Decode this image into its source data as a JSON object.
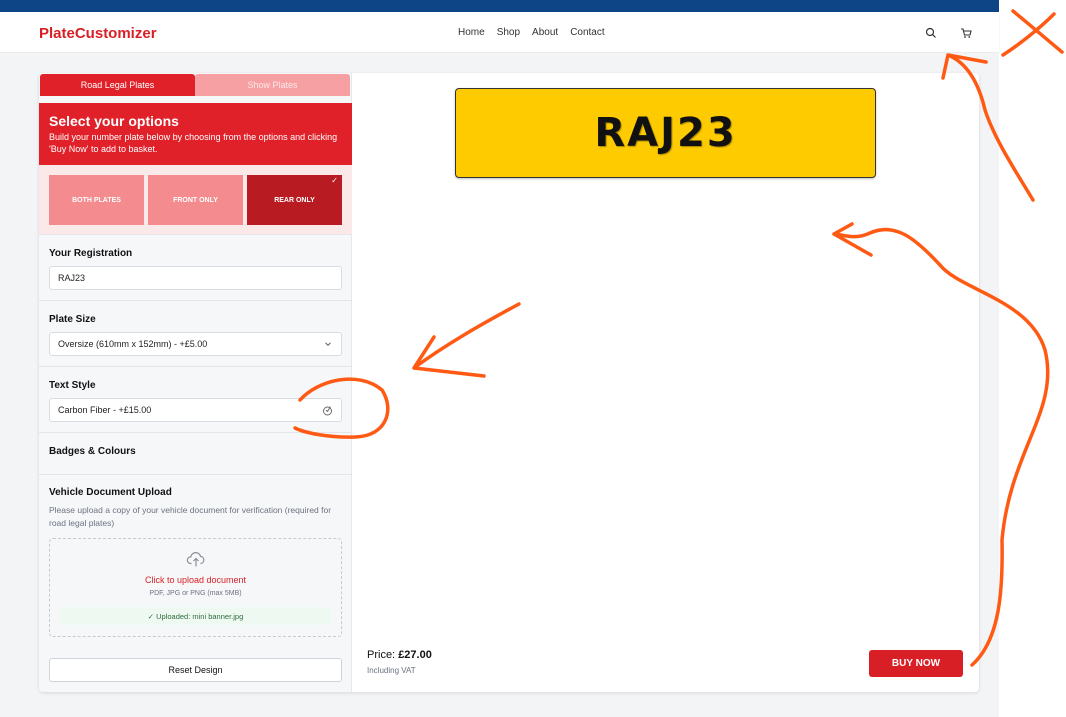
{
  "header": {
    "logo": "PlateCustomizer",
    "nav": [
      "Home",
      "Shop",
      "About",
      "Contact"
    ],
    "icons": [
      "search-icon",
      "cart-icon"
    ]
  },
  "tabs": [
    {
      "label": "Road Legal Plates",
      "active": true
    },
    {
      "label": "Show Plates",
      "active": false
    }
  ],
  "options": {
    "title": "Select your options",
    "subtitle": "Build your number plate below by choosing from the options and clicking 'Buy Now' to add to basket.",
    "coverage": [
      {
        "label": "BOTH PLATES",
        "selected": false
      },
      {
        "label": "FRONT ONLY",
        "selected": false
      },
      {
        "label": "REAR ONLY",
        "selected": true
      }
    ],
    "check": "✓"
  },
  "registration": {
    "label": "Your Registration",
    "value": "RAJ23"
  },
  "plate_size": {
    "label": "Plate Size",
    "value": "Oversize (610mm x 152mm) - +£5.00"
  },
  "text_style": {
    "label": "Text Style",
    "value": "Carbon Fiber - +£15.00"
  },
  "badges": {
    "label": "Badges & Colours"
  },
  "upload": {
    "label": "Vehicle Document Upload",
    "description": "Please upload a copy of your vehicle document for verification (required for road legal plates)",
    "cta": "Click to upload document",
    "formats": "PDF, JPG or PNG (max 5MB)",
    "status": "✓ Uploaded: mini banner.jpg"
  },
  "reset_label": "Reset Design",
  "preview": {
    "plate_text": "RAJ23",
    "plate_color": "#fecb00"
  },
  "price": {
    "label": "Price:",
    "amount": "£27.00",
    "note": "Including VAT"
  },
  "buy_label": "BUY NOW",
  "colors": {
    "brand": "#d91f26",
    "topbar": "#0d4587",
    "annotation": "#ff5a14"
  }
}
